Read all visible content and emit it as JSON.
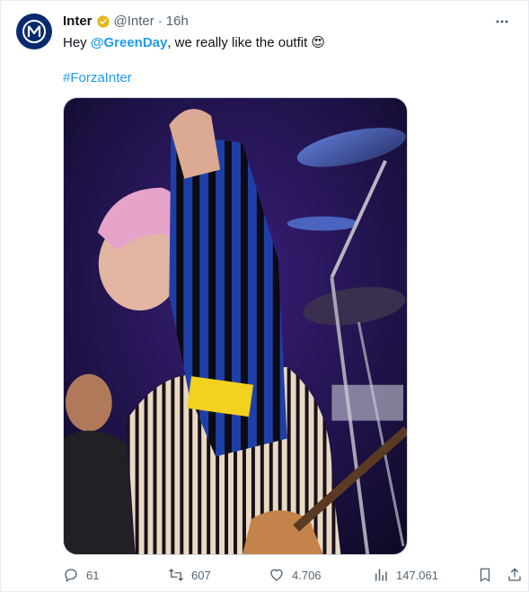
{
  "tweet": {
    "author_name": "Inter",
    "handle": "@Inter",
    "separator": "·",
    "time": "16h",
    "text_before": "Hey ",
    "mention": "@GreenDay",
    "text_after": ", we really like the outfit ",
    "emoji": "😍",
    "hashtag": "#ForzaInter"
  },
  "icons": {
    "avatar": "inter-logo-icon",
    "verified": "verified-badge-icon",
    "more": "more-options-icon",
    "reply": "reply-icon",
    "retweet": "retweet-icon",
    "like": "heart-icon",
    "views": "views-chart-icon",
    "bookmark": "bookmark-icon",
    "share": "share-icon"
  },
  "actions": {
    "replies": "61",
    "retweets": "607",
    "likes": "4.706",
    "views": "147.061"
  },
  "colors": {
    "link": "#1d9bf0",
    "muted": "#536471",
    "brand": "#0a2a6e",
    "verified_gold": "#e2b719"
  }
}
